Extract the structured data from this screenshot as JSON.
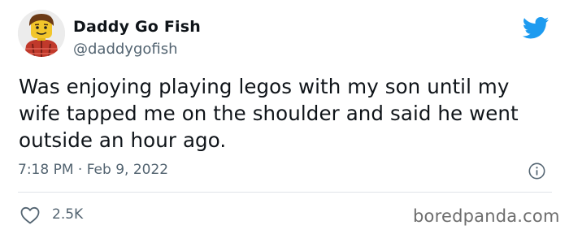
{
  "author": {
    "name": "Daddy Go Fish",
    "handle": "@daddygofish"
  },
  "tweet": {
    "text": "Was enjoying playing legos with my son until my wife tapped me on the shoulder and said he went outside an hour ago.",
    "timestamp": "7:18 PM · Feb 9, 2022",
    "likes": "2.5K"
  },
  "icons": {
    "brand": "twitter-bird-icon",
    "info": "info-icon",
    "like": "heart-icon"
  },
  "colors": {
    "twitter_blue": "#1d9bf0",
    "secondary_text": "#536471"
  },
  "watermark": "boredpanda.com"
}
